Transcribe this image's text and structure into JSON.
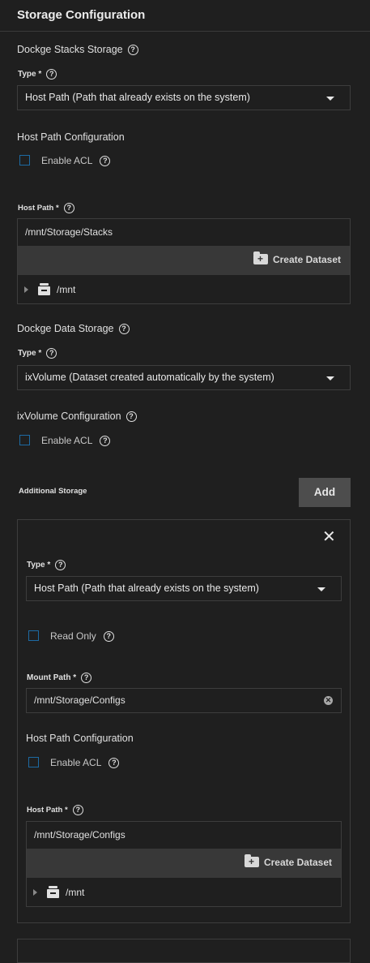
{
  "page": {
    "title": "Storage Configuration"
  },
  "stacks_storage": {
    "heading": "Dockge Stacks Storage",
    "type_label": "Type",
    "required_mark": "*",
    "type_value": "Host Path (Path that already exists on the system)",
    "config_heading": "Host Path Configuration",
    "acl_label": "Enable ACL",
    "host_path_label": "Host Path",
    "host_path_value": "/mnt/Storage/Stacks",
    "create_dataset_label": "Create Dataset",
    "tree_root": "/mnt"
  },
  "data_storage": {
    "heading": "Dockge Data Storage",
    "type_label": "Type",
    "required_mark": "*",
    "type_value": "ixVolume (Dataset created automatically by the system)",
    "config_heading": "ixVolume Configuration",
    "acl_label": "Enable ACL"
  },
  "additional_storage": {
    "heading": "Additional Storage",
    "add_label": "Add",
    "item": {
      "type_label": "Type",
      "required_mark": "*",
      "type_value": "Host Path (Path that already exists on the system)",
      "read_only_label": "Read Only",
      "mount_path_label": "Mount Path",
      "mount_path_value": "/mnt/Storage/Configs",
      "config_heading": "Host Path Configuration",
      "acl_label": "Enable ACL",
      "host_path_label": "Host Path",
      "host_path_value": "/mnt/Storage/Configs",
      "create_dataset_label": "Create Dataset",
      "tree_root": "/mnt"
    }
  },
  "icons": {
    "help": "help-circle-icon",
    "dropdown": "caret-down-icon",
    "close": "close-icon",
    "clear": "clear-icon",
    "create_folder": "folder-plus-icon",
    "expand": "triangle-right-icon",
    "dataset": "dataset-drive-icon"
  },
  "colors": {
    "background": "#1f1f1f",
    "border": "#3d3d3d",
    "checkbox_border": "#1d6aa3",
    "toolbar": "#383838",
    "add_button": "#4d4d4d"
  }
}
